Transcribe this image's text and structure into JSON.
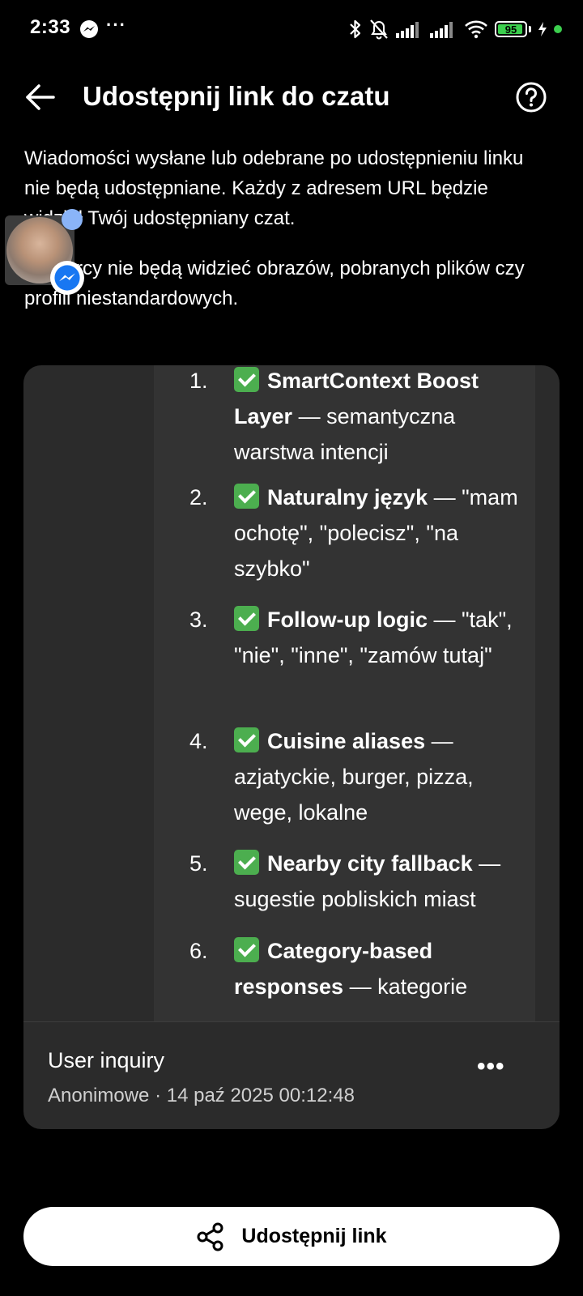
{
  "status_bar": {
    "time": "2:33",
    "battery": "95",
    "battery_level": 0.95,
    "icons": [
      "messenger-icon",
      "more-dots-icon",
      "bluetooth-icon",
      "bell-off-icon",
      "signal-icon",
      "signal-icon",
      "wifi-icon",
      "battery-icon",
      "charging-icon"
    ]
  },
  "header": {
    "title": "Udostępnij link do czatu",
    "back_icon": "arrow-left-icon",
    "help_icon": "help-circle-icon"
  },
  "description": {
    "paragraph1": "Wiadomości wysłane lub odebrane po udostępnieniu linku nie będą udostępniane. Każdy z adresem URL będzie widział Twój udostępniany czat.",
    "paragraph2": "Odbiorcy nie będą widzieć obrazów, pobranych plików czy profili niestandardowych."
  },
  "preview": {
    "items": [
      {
        "num": "1.",
        "title": "SmartContext Boost Layer",
        "text": " — semantyczna warstwa intencji"
      },
      {
        "num": "2.",
        "title": "Naturalny język",
        "text": " — \"mam ochotę\", \"polecisz\", \"na szybko\""
      },
      {
        "num": "3.",
        "title": "Follow-up logic",
        "text": " — \"tak\", \"nie\", \"inne\", \"zamów tutaj\""
      },
      {
        "num": "4.",
        "title": "Cuisine aliases",
        "text": " — azjatyckie, burger, pizza, wege, lokalne"
      },
      {
        "num": "5.",
        "title": "Nearby city fallback",
        "text": " — sugestie pobliskich miast"
      },
      {
        "num": "6.",
        "title": "Category-based responses",
        "text": " — kategorie"
      }
    ]
  },
  "card": {
    "title": "User inquiry",
    "subtitle": "Anonimowe · 14 paź 2025 00:12:48",
    "more_label": "•••"
  },
  "share_button": {
    "label": "Udostępnij link",
    "icon": "share-icon"
  },
  "colors": {
    "background": "#000000",
    "card": "#2b2b2b",
    "check": "#4cae4f",
    "battery": "#3ccf4e",
    "chathead_dot": "#8ab4f8"
  }
}
